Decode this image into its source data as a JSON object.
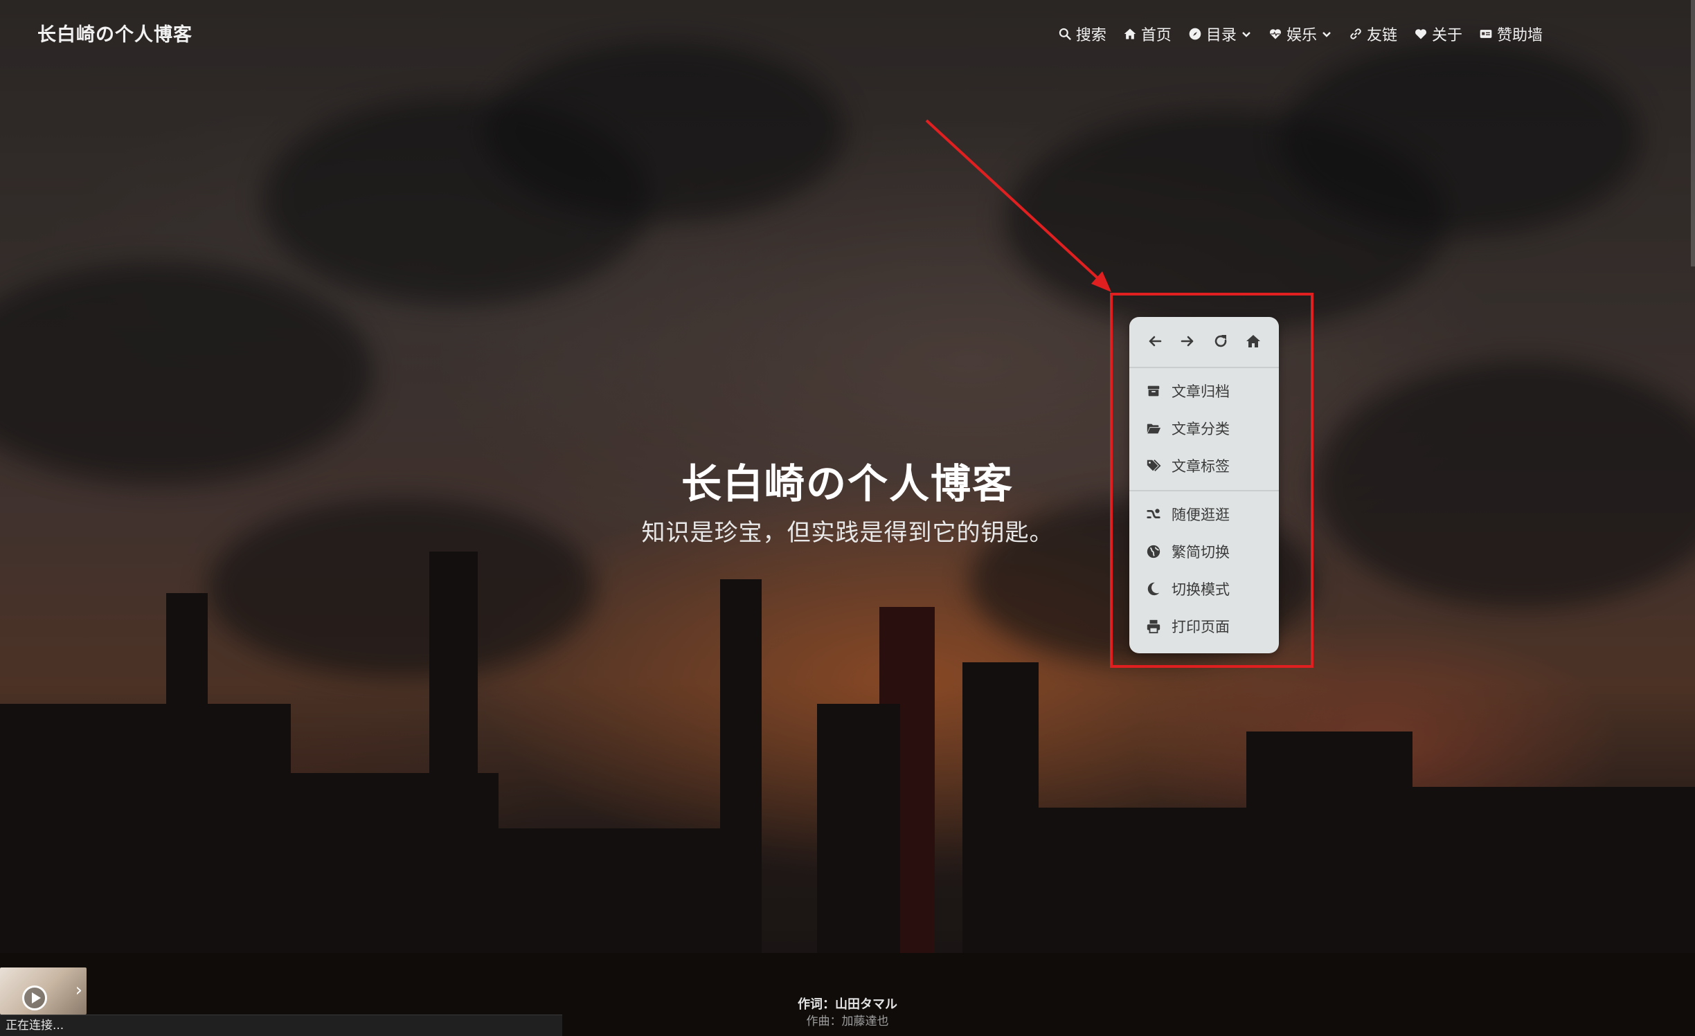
{
  "site": {
    "title": "长白崎の个人博客"
  },
  "nav": [
    {
      "label": "搜索",
      "icon": "search-icon"
    },
    {
      "label": "首页",
      "icon": "home-icon"
    },
    {
      "label": "目录",
      "icon": "compass-icon",
      "dropdown": true
    },
    {
      "label": "娱乐",
      "icon": "heart-pulse-icon",
      "dropdown": true
    },
    {
      "label": "友链",
      "icon": "link-icon"
    },
    {
      "label": "关于",
      "icon": "heart-icon"
    },
    {
      "label": "赞助墙",
      "icon": "id-card-icon"
    }
  ],
  "hero": {
    "title": "长白崎の个人博客",
    "subtitle": "知识是珍宝，但实践是得到它的钥匙。"
  },
  "context_menu": {
    "toolbar": [
      "back-arrow-icon",
      "forward-arrow-icon",
      "refresh-icon",
      "home-icon"
    ],
    "group1": [
      {
        "label": "文章归档",
        "icon": "archive-icon"
      },
      {
        "label": "文章分类",
        "icon": "folder-open-icon"
      },
      {
        "label": "文章标签",
        "icon": "tags-icon"
      }
    ],
    "group2": [
      {
        "label": "随便逛逛",
        "icon": "shuffle-icon"
      },
      {
        "label": "繁简切换",
        "icon": "globe-icon"
      },
      {
        "label": "切换模式",
        "icon": "moon-icon"
      },
      {
        "label": "打印页面",
        "icon": "printer-icon"
      }
    ]
  },
  "player": {
    "lyric_line1": "作词：山田タマル",
    "lyric_line2": "作曲：加藤達也"
  },
  "status_bar": {
    "text": "正在连接..."
  },
  "colors": {
    "annotation": "#e02020",
    "menu_bg": "#dfe3e3",
    "menu_text": "#3b3b3b"
  }
}
